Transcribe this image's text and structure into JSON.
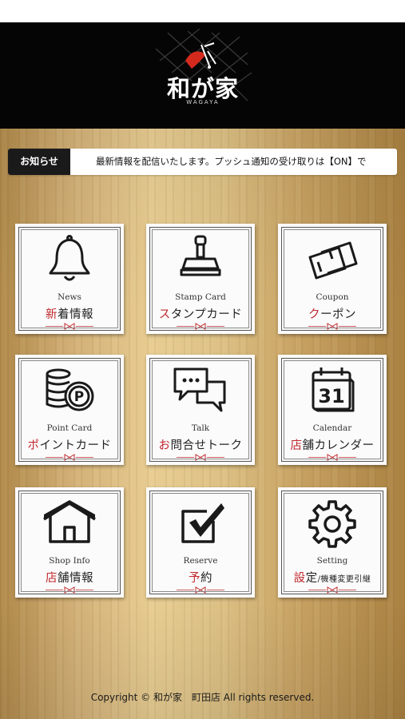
{
  "header": {
    "logo_text": "和が家",
    "logo_sub": "WAGAYA"
  },
  "news": {
    "label": "お知らせ",
    "text": "最新情報を配信いたします。プッシュ通知の受け取りは【ON】で"
  },
  "menu": [
    {
      "en": "News",
      "jp_first": "新",
      "jp_rest": "着情報",
      "icon": "bell-icon"
    },
    {
      "en": "Stamp Card",
      "jp_first": "ス",
      "jp_rest": "タンプカード",
      "icon": "stamp-icon"
    },
    {
      "en": "Coupon",
      "jp_first": "ク",
      "jp_rest": "ーポン",
      "icon": "coupon-icon"
    },
    {
      "en": "Point Card",
      "jp_first": "ポ",
      "jp_rest": "イントカード",
      "icon": "coins-icon"
    },
    {
      "en": "Talk",
      "jp_first": "お",
      "jp_rest": "問合せトーク",
      "icon": "chat-icon"
    },
    {
      "en": "Calendar",
      "jp_first": "店",
      "jp_rest": "舗カレンダー",
      "icon": "calendar-icon",
      "day": "31"
    },
    {
      "en": "Shop Info",
      "jp_first": "店",
      "jp_rest": "舗情報",
      "icon": "shop-icon"
    },
    {
      "en": "Reserve",
      "jp_first": "予",
      "jp_rest": "約",
      "icon": "checkbox-icon"
    },
    {
      "en": "Setting",
      "jp_first": "設",
      "jp_rest": "定",
      "jp_small": "/機種変更引継",
      "icon": "gear-icon"
    }
  ],
  "footer": {
    "copyright": "Copyright © 和が家　町田店 All rights reserved."
  },
  "colors": {
    "accent_red": "#c0282d",
    "header_bg": "#050505"
  }
}
